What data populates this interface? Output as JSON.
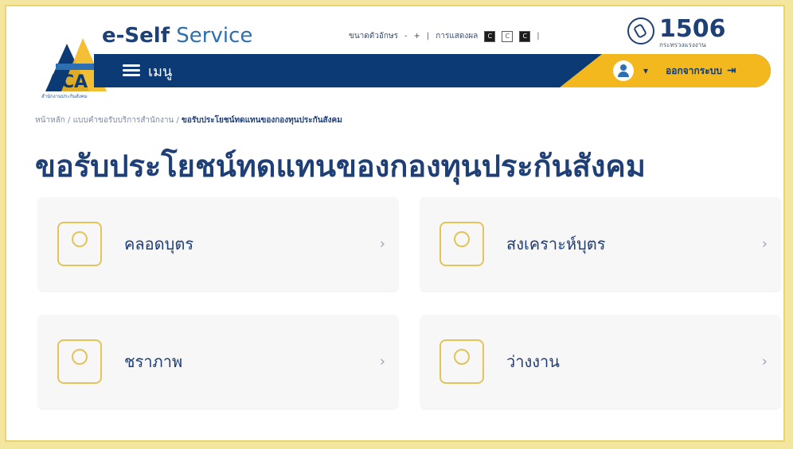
{
  "header": {
    "brand_strong": "e-Self",
    "brand_light": " Service",
    "toolbar": {
      "font_size_label": "ขนาดตัวอักษร",
      "minus": "-",
      "plus": "+",
      "separator": "|",
      "display_label": "การแสดงผล",
      "contrast_options": [
        "C",
        "C",
        "C"
      ]
    },
    "hotline": {
      "number": "1506",
      "subtext": "กระทรวงแรงงาน"
    },
    "logo_tagline": "สำนักงานประกันสังคม"
  },
  "nav": {
    "menu_label": "เมนู",
    "user_caret": "▾",
    "logout_label": "ออกจากระบบ"
  },
  "breadcrumb": {
    "home": "หน้าหลัก",
    "mid": "แบบคำขอรับบริการสำนักงาน",
    "current": "ขอรับประโยชน์ทดแทนของกองทุนประกันสังคม",
    "sep": " / "
  },
  "page_title": "ขอรับประโยชน์ทดแทนของกองทุนประกันสังคม",
  "cards": [
    {
      "label": "คลอดบุตร",
      "icon": "childbirth-icon"
    },
    {
      "label": "สงเคราะห์บุตร",
      "icon": "child-support-icon"
    },
    {
      "label": "ชราภาพ",
      "icon": "old-age-icon"
    },
    {
      "label": "ว่างงาน",
      "icon": "unemployment-icon"
    }
  ],
  "colors": {
    "primary_navy": "#0b3a74",
    "accent_yellow": "#f4b81f",
    "icon_gold": "#e3c35a",
    "frame_yellow": "#f3e7a0"
  }
}
